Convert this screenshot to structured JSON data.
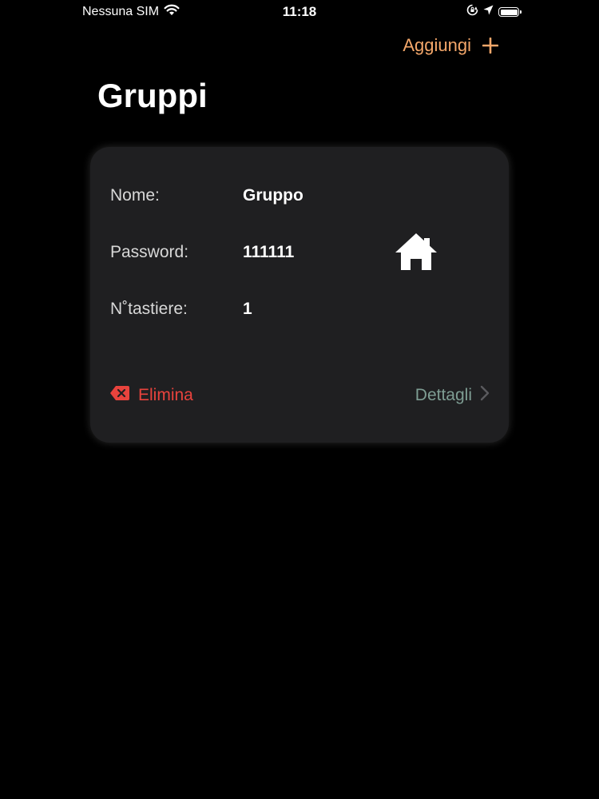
{
  "status_bar": {
    "carrier": "Nessuna SIM",
    "time": "11:18",
    "battery_level": 1.0
  },
  "header": {
    "add_label": "Aggiungi",
    "title": "Gruppi"
  },
  "colors": {
    "accent": "#f4a76a",
    "delete": "#e8433d",
    "details": "#7e9d93",
    "card_bg": "#1f1f21",
    "background": "#000000"
  },
  "card": {
    "name_label": "Nome:",
    "name_value": "Gruppo",
    "password_label": "Password:",
    "password_value": "111111",
    "keypads_label": "N˚tastiere:",
    "keypads_value": "1",
    "icon": "home-icon",
    "delete_label": "Elimina",
    "details_label": "Dettagli"
  }
}
